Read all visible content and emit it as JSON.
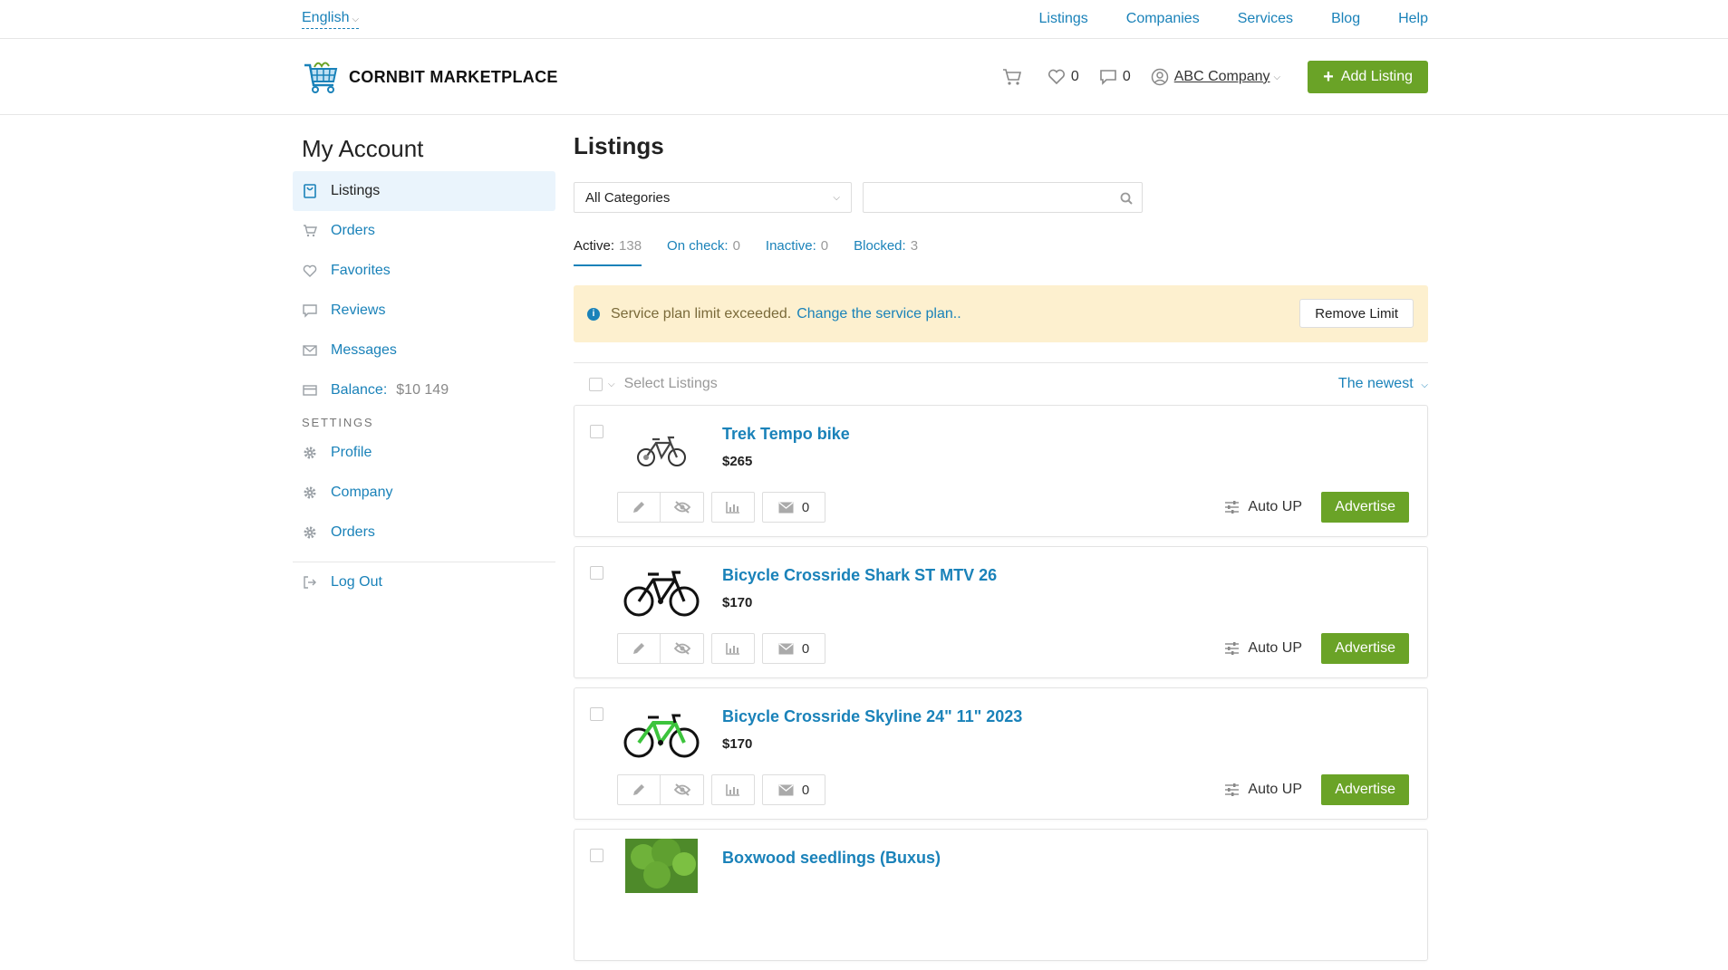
{
  "topbar": {
    "language": "English",
    "nav": [
      "Listings",
      "Companies",
      "Services",
      "Blog",
      "Help"
    ]
  },
  "header": {
    "brand": "CORNBIT MARKETPLACE",
    "favorites_count": "0",
    "messages_count": "0",
    "company": "ABC Company",
    "add_listing": "Add Listing"
  },
  "sidebar": {
    "title": "My Account",
    "items": [
      {
        "label": "Listings",
        "icon": "bag-icon"
      },
      {
        "label": "Orders",
        "icon": "cart-icon"
      },
      {
        "label": "Favorites",
        "icon": "heart-icon"
      },
      {
        "label": "Reviews",
        "icon": "comment-icon"
      },
      {
        "label": "Messages",
        "icon": "envelope-icon"
      },
      {
        "label": "Balance:",
        "icon": "card-icon",
        "value": "$10 149"
      }
    ],
    "settings_title": "SETTINGS",
    "settings": [
      {
        "label": "Profile",
        "icon": "gear-icon"
      },
      {
        "label": "Company",
        "icon": "gear-icon"
      },
      {
        "label": "Orders",
        "icon": "gear-icon"
      }
    ],
    "logout": "Log Out"
  },
  "main": {
    "title": "Listings",
    "category_select": "All Categories",
    "search_placeholder": "",
    "tabs": [
      {
        "label": "Active:",
        "count": "138"
      },
      {
        "label": "On check:",
        "count": "0"
      },
      {
        "label": "Inactive:",
        "count": "0"
      },
      {
        "label": "Blocked:",
        "count": "3"
      }
    ],
    "alert": {
      "text": "Service plan limit exceeded.",
      "link": "Change the service plan..",
      "button": "Remove Limit"
    },
    "select_listings": "Select Listings",
    "sort": "The newest",
    "auto_up": "Auto UP",
    "advertise": "Advertise",
    "listings": [
      {
        "title": "Trek Tempo bike",
        "price": "$265",
        "messages": "0"
      },
      {
        "title": "Bicycle Crossride Shark ST MTV 26",
        "price": "$170",
        "messages": "0"
      },
      {
        "title": "Bicycle Crossride Skyline 24\" 11\" 2023",
        "price": "$170",
        "messages": "0"
      },
      {
        "title": "Boxwood seedlings (Buxus)",
        "price": "",
        "messages": ""
      }
    ]
  },
  "colors": {
    "accent": "#1a82b9",
    "green": "#6aa327",
    "alert_bg": "#fdf0cf"
  }
}
